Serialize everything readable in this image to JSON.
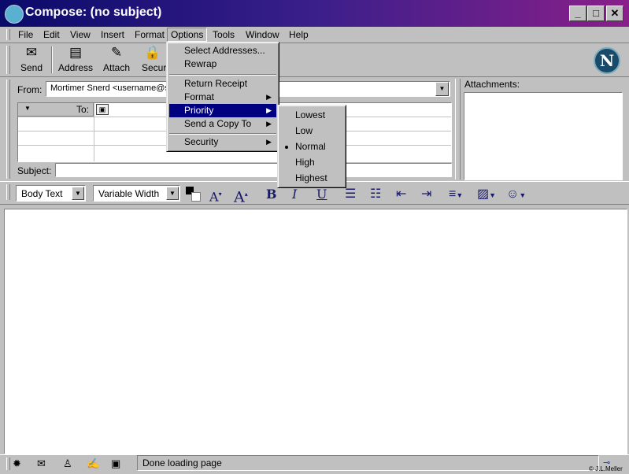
{
  "window": {
    "title": "Compose: (no subject)",
    "controls": {
      "minimize": "_",
      "maximize": "□",
      "close": "✕"
    }
  },
  "menubar": [
    "File",
    "Edit",
    "View",
    "Insert",
    "Format",
    "Options",
    "Tools",
    "Window",
    "Help"
  ],
  "toolbar": {
    "send": "Send",
    "address": "Address",
    "attach": "Attach",
    "security": "Securi",
    "logo": "N"
  },
  "address": {
    "from_label": "From:",
    "from_value": "Mortimer Snerd <username@se",
    "to_label": "To:",
    "subject_label": "Subject:",
    "subject_value": "",
    "attachments_label": "Attachments:"
  },
  "formatbar": {
    "paragraph_style": "Body Text",
    "font": "Variable Width",
    "bold": "B",
    "italic": "I",
    "underline": "U"
  },
  "options_menu": {
    "items": [
      "Select Addresses...",
      "Rewrap",
      "Return Receipt",
      "Format",
      "Priority",
      "Send a Copy To",
      "Security"
    ],
    "highlighted": "Priority"
  },
  "priority_menu": {
    "items": [
      "Lowest",
      "Low",
      "Normal",
      "High",
      "Highest"
    ],
    "selected": "Normal"
  },
  "status": {
    "text": "Done loading page"
  },
  "copyright": "© J.L.Meller",
  "colors": {
    "title_start": "#0a0a6a",
    "title_end": "#8a1f8a",
    "highlight": "#000080",
    "chrome": "#c0c0c0"
  }
}
